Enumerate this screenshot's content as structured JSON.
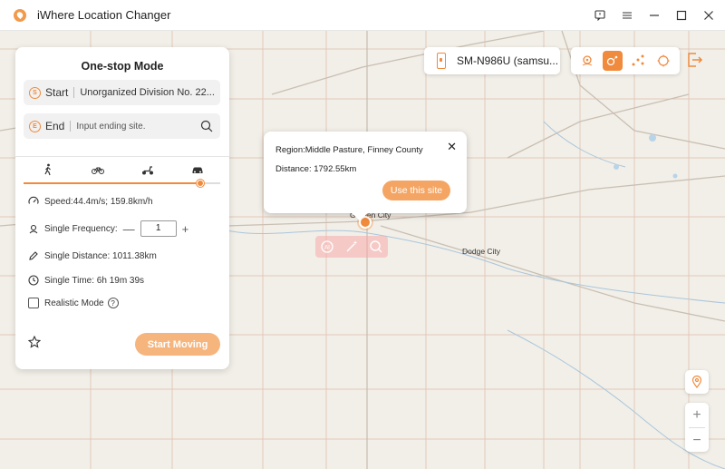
{
  "window": {
    "title": "iWhere Location Changer",
    "controls": [
      "feedback-icon",
      "menu-icon",
      "minimize-icon",
      "maximize-icon",
      "close-icon"
    ]
  },
  "panel": {
    "title": "One-stop Mode",
    "start": {
      "label": "Start",
      "badge": "S",
      "value": "Unorganized Division No. 22..."
    },
    "end": {
      "label": "End",
      "badge": "E",
      "placeholder": "Input ending site."
    },
    "modes": [
      "walk-icon",
      "bicycle-icon",
      "scooter-icon",
      "car-icon"
    ],
    "speed_level": 0.9,
    "speed_text": "Speed:44.4m/s; 159.8km/h",
    "frequency_label": "Single Frequency:",
    "frequency_minus": "—",
    "frequency_value": "1",
    "frequency_plus": "+",
    "distance_text": "Single Distance: 1011.38km",
    "time_text": "Single Time: 6h 19m 39s",
    "realistic_label": "Realistic Mode",
    "realistic_checked": false,
    "help_glyph": "?",
    "start_button": "Start Moving"
  },
  "device": {
    "name": "SM-N986U (samsu..."
  },
  "toolbar": {
    "tools": [
      "teleport-icon",
      "one-stop-icon",
      "multi-stop-icon",
      "joystick-icon"
    ],
    "active_tool": "one-stop-icon"
  },
  "popup": {
    "region": "Region:Middle Pasture, Finney County",
    "distance": "Distance: 1792.55km",
    "close": "✕",
    "button": "Use this site"
  },
  "map": {
    "labels": {
      "garden_city": "Garden City",
      "dodge_city": "Dodge City"
    }
  },
  "zoom": {
    "in": "+",
    "out": "−"
  },
  "colors": {
    "accent": "#f08a3c",
    "button_light": "#f5b57d",
    "map_bg": "#f2efe8"
  }
}
